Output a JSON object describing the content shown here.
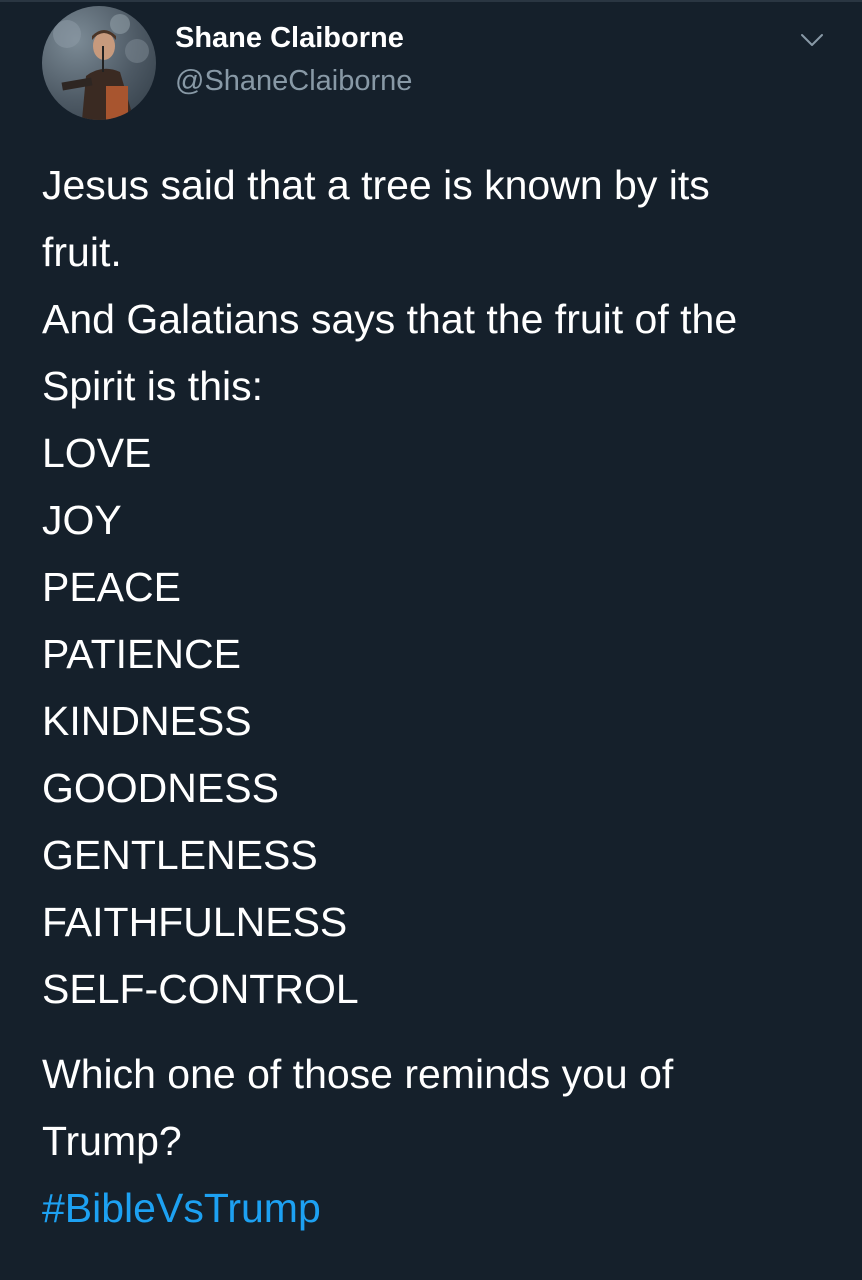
{
  "author": {
    "display_name": "Shane Claiborne",
    "handle": "@ShaneClaiborne",
    "avatar_icon": "profile-photo",
    "menu_icon": "chevron-down-icon"
  },
  "tweet": {
    "intro_lines": [
      "Jesus said that a tree is known by its",
      "fruit.",
      "And Galatians says that the fruit of the",
      "Spirit is this:"
    ],
    "fruits": [
      "LOVE",
      "JOY",
      "PEACE",
      "PATIENCE",
      "KINDNESS",
      "GOODNESS",
      "GENTLENESS",
      "FAITHFULNESS",
      "SELF-CONTROL"
    ],
    "question_lines": [
      "Which one of those reminds you of",
      "Trump?"
    ],
    "hashtag": "#BibleVsTrump"
  },
  "colors": {
    "background": "#15202b",
    "text": "#ffffff",
    "secondary_text": "#8899a6",
    "link": "#1da1f2"
  }
}
